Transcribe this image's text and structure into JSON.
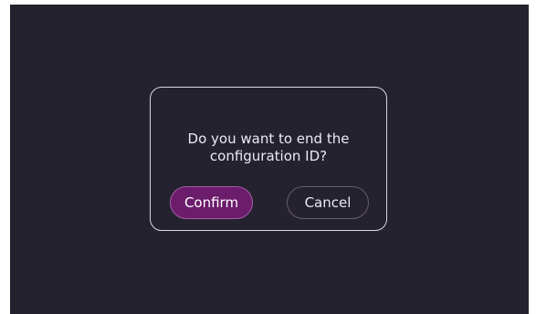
{
  "dialog": {
    "message": "Do you want to end the\nconfiguration ID?",
    "confirm_label": "Confirm",
    "cancel_label": "Cancel"
  },
  "colors": {
    "background": "#24222e",
    "dialog_border": "#d9d6e3",
    "confirm_fill": "#6b1c6b",
    "confirm_border": "#a45ca3",
    "cancel_border": "#6c5a72",
    "text": "#ece9f3"
  }
}
